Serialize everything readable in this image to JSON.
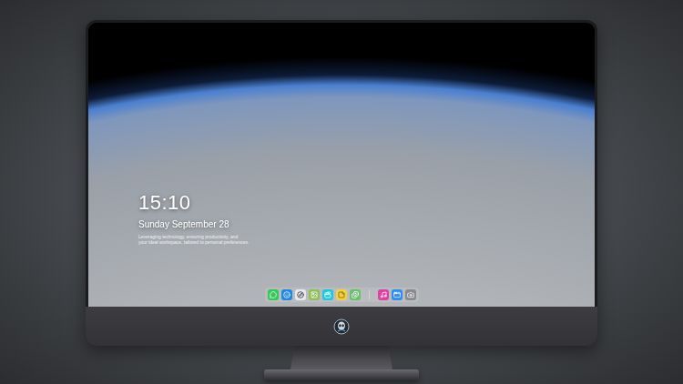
{
  "clock": {
    "time": "15:10",
    "date": "Sunday September 28",
    "notes": [
      "Leveraging technology, ensuring productivity, and",
      "your ideal workspace, tailored to personal preferences."
    ]
  }
}
